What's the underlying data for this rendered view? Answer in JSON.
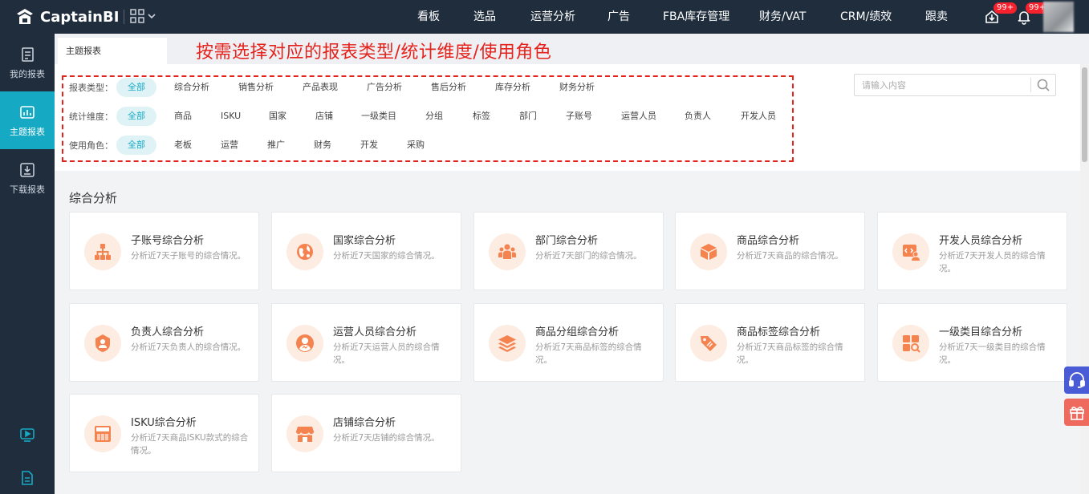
{
  "brand": {
    "name": "CaptainBI"
  },
  "nav": [
    "看板",
    "选品",
    "运营分析",
    "广告",
    "FBA库存管理",
    "财务/VAT",
    "CRM/绩效",
    "跟卖"
  ],
  "notifications": {
    "task_badge": "99+",
    "bell_badge": "99+"
  },
  "sidebar": [
    {
      "label": "我的报表"
    },
    {
      "label": "主题报表"
    },
    {
      "label": "下载报表"
    }
  ],
  "tab": {
    "label": "主题报表"
  },
  "hint": "按需选择对应的报表类型/统计维度/使用角色",
  "filters": {
    "report_type": {
      "label": "报表类型：",
      "options": [
        "全部",
        "综合分析",
        "销售分析",
        "产品表现",
        "广告分析",
        "售后分析",
        "库存分析",
        "财务分析"
      ],
      "selected": "全部"
    },
    "dimension": {
      "label": "统计维度：",
      "options": [
        "全部",
        "商品",
        "ISKU",
        "国家",
        "店铺",
        "一级类目",
        "分组",
        "标签",
        "部门",
        "子账号",
        "运营人员",
        "负责人",
        "开发人员"
      ],
      "selected": "全部"
    },
    "role": {
      "label": "使用角色：",
      "options": [
        "全部",
        "老板",
        "运营",
        "推广",
        "财务",
        "开发",
        "采购"
      ],
      "selected": "全部"
    }
  },
  "search": {
    "placeholder": "请输入内容"
  },
  "section": {
    "title": "综合分析"
  },
  "cards": [
    {
      "title": "子账号综合分析",
      "desc": "分析近7天子账号的综合情况。",
      "icon": "org-chart-icon"
    },
    {
      "title": "国家综合分析",
      "desc": "分析近7天国家的综合情况。",
      "icon": "globe-icon"
    },
    {
      "title": "部门综合分析",
      "desc": "分析近7天部门的综合情况。",
      "icon": "team-icon"
    },
    {
      "title": "商品综合分析",
      "desc": "分析近7天商品的综合情况。",
      "icon": "box-icon"
    },
    {
      "title": "开发人员综合分析",
      "desc": "分析近7天开发人员的综合情况。",
      "icon": "developer-icon"
    },
    {
      "title": "负责人综合分析",
      "desc": "分析近7天负责人的综合情况。",
      "icon": "owner-icon"
    },
    {
      "title": "运营人员综合分析",
      "desc": "分析近7天运营人员的综合情况。",
      "icon": "operator-icon"
    },
    {
      "title": "商品分组综合分析",
      "desc": "分析近7天商品标签的综合情况。",
      "icon": "layers-icon"
    },
    {
      "title": "商品标签综合分析",
      "desc": "分析近7天商品标签的综合情况。",
      "icon": "tag-icon"
    },
    {
      "title": "一级类目综合分析",
      "desc": "分析近7天一级类目的综合情况。",
      "icon": "category-icon"
    },
    {
      "title": "ISKU综合分析",
      "desc": "分析近7天商品ISKU款式的综合情况。",
      "icon": "isku-icon"
    },
    {
      "title": "店铺综合分析",
      "desc": "分析近7天店铺的综合情况。",
      "icon": "shop-icon"
    }
  ],
  "colors": {
    "accent": "#16a9c4",
    "icon_orange": "#f5834f",
    "hint_red": "#e5231d",
    "topbar": "#1f2d3d"
  }
}
